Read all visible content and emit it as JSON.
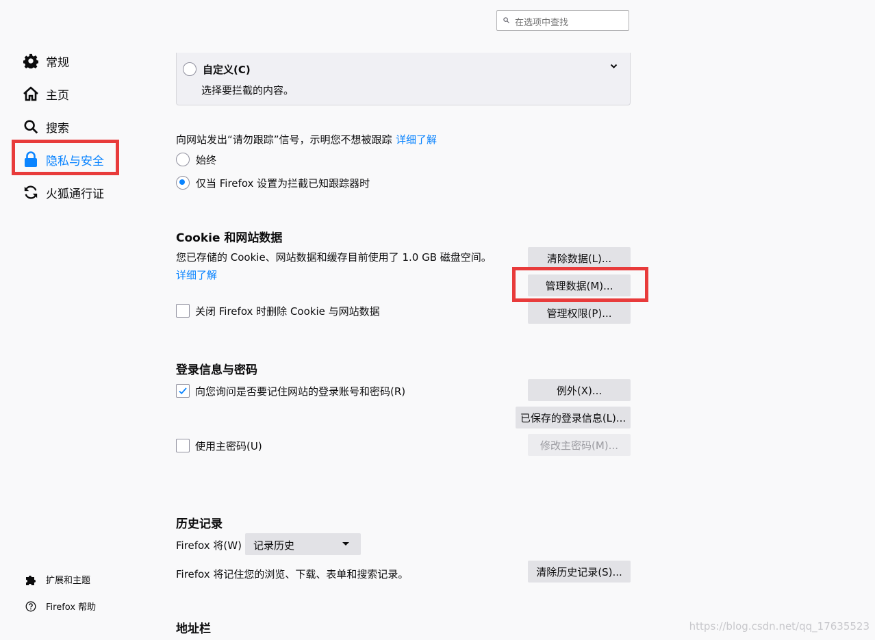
{
  "search": {
    "placeholder": "在选项中查找"
  },
  "sidebar": {
    "items": [
      {
        "label": "常规",
        "icon": "gear-icon"
      },
      {
        "label": "主页",
        "icon": "home-icon"
      },
      {
        "label": "搜索",
        "icon": "search-icon"
      },
      {
        "label": "隐私与安全",
        "icon": "lock-icon",
        "active": true
      },
      {
        "label": "火狐通行证",
        "icon": "sync-icon"
      }
    ],
    "bottom": [
      {
        "label": "扩展和主题",
        "icon": "puzzle-icon"
      },
      {
        "label": "Firefox 帮助",
        "icon": "help-icon"
      }
    ]
  },
  "tracking": {
    "custom_title": "自定义(C)",
    "custom_desc": "选择要拦截的内容。"
  },
  "dnt": {
    "text": "向网站发出“请勿跟踪”信号，示明您不想被跟踪",
    "learn_more": "详细了解",
    "option_always": "始终",
    "option_only": "仅当 Firefox 设置为拦截已知跟踪器时",
    "selected": "option_only"
  },
  "cookies": {
    "title": "Cookie 和网站数据",
    "desc": "您已存储的 Cookie、网站数据和缓存目前使用了 1.0 GB 磁盘空间。",
    "learn_more": "详细了解",
    "delete_on_close": "关闭 Firefox 时删除 Cookie 与网站数据",
    "delete_on_close_checked": false,
    "btn_clear": "清除数据(L)...",
    "btn_manage": "管理数据(M)...",
    "btn_permissions": "管理权限(P)..."
  },
  "logins": {
    "title": "登录信息与密码",
    "ask_save": "向您询问是否要记住网站的登录账号和密码(R)",
    "ask_save_checked": true,
    "master_password": "使用主密码(U)",
    "master_password_checked": false,
    "btn_exceptions": "例外(X)...",
    "btn_saved": "已保存的登录信息(L)...",
    "btn_change_master": "修改主密码(M)..."
  },
  "history": {
    "title": "历史记录",
    "will_label": "Firefox 将(W)",
    "select_value": "记录历史",
    "desc": "Firefox 将记住您的浏览、下载、表单和搜索记录。",
    "btn_clear": "清除历史记录(S)..."
  },
  "addressbar": {
    "title": "地址栏"
  },
  "watermark": "https://blog.csdn.net/qq_17635523",
  "colors": {
    "accent": "#0a84ff",
    "highlight": "#e83b3b"
  }
}
